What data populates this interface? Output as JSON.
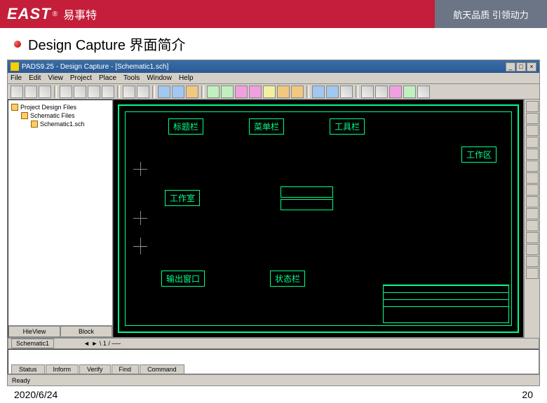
{
  "banner": {
    "logo": "EAST",
    "reg": "®",
    "cn": "易事特",
    "right": "航天品质 引领动力"
  },
  "slide": {
    "title": "Design Capture 界面简介"
  },
  "window": {
    "title": "PADS9.25 - Design Capture - [Schematic1.sch]"
  },
  "menu": {
    "file": "File",
    "edit": "Edit",
    "view": "View",
    "project": "Project",
    "place": "Place",
    "tools": "Tools",
    "window": "Window",
    "help": "Help"
  },
  "tree": {
    "root": "Project Design Files",
    "sch": "Schematic Files",
    "file": "Schematic1.sch"
  },
  "leftTabs": {
    "hier": "HieView",
    "block": "Block"
  },
  "labels": {
    "title": "标题栏",
    "menu": "菜单栏",
    "toolbar": "工具栏",
    "workarea": "工作区",
    "workspace": "工作室",
    "output": "输出窗口",
    "status": "状态栏"
  },
  "bottomTab": "Schematic1",
  "sheetTab": "1",
  "outputTabs": {
    "status": "Status",
    "inform": "Inform",
    "verify": "Verify",
    "find": "Find",
    "command": "Command"
  },
  "status": "Ready",
  "footer": {
    "date": "2020/6/24",
    "page": "20"
  }
}
